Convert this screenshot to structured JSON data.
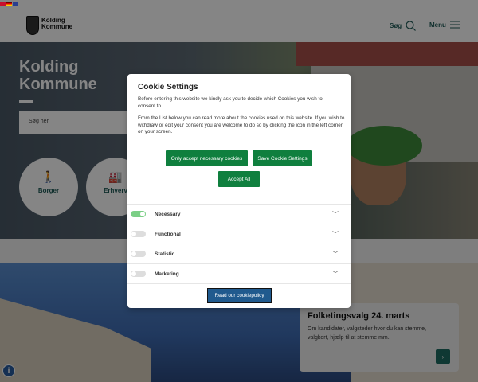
{
  "header": {
    "logo_line1": "Kolding",
    "logo_line2": "Kommune",
    "search_label": "Søg",
    "menu_label": "Menu"
  },
  "languages": [
    "Danish",
    "German",
    "English"
  ],
  "hero": {
    "title_line1": "Kolding",
    "title_line2": "Kommune",
    "search_placeholder": "Søg her",
    "circles": [
      {
        "label": "Borger",
        "icon": "person-icon"
      },
      {
        "label": "Erhverv",
        "icon": "factory-icon"
      }
    ]
  },
  "news": {
    "title": "Folketingsvalg 24. marts",
    "text": "Om kandidater, valgsteder hvor du kan stemme, valgkort, hjælp til at stemme mm.",
    "arrow": "›"
  },
  "cookie": {
    "title": "Cookie Settings",
    "paragraph1": "Before entering this website we kindly ask you to decide which Cookies you wish to consent to.",
    "paragraph2": "From the List below you can read more about the cookies used on this website. If you wish to withdraw or edit your consent you are welcome to do so by clicking the icon in the left corner on your screen.",
    "btn_necessary": "Only accept necessary cookies",
    "btn_save": "Save Cookie Settings",
    "btn_accept_all": "Accept All",
    "categories": [
      {
        "label": "Necessary",
        "enabled": true
      },
      {
        "label": "Functional",
        "enabled": false
      },
      {
        "label": "Statistic",
        "enabled": false
      },
      {
        "label": "Marketing",
        "enabled": false
      }
    ],
    "policy_link": "Read our cookiepolicy"
  },
  "colors": {
    "green": "#0f7f3e",
    "teal": "#1e5a56",
    "policy_blue": "#205a8e"
  }
}
